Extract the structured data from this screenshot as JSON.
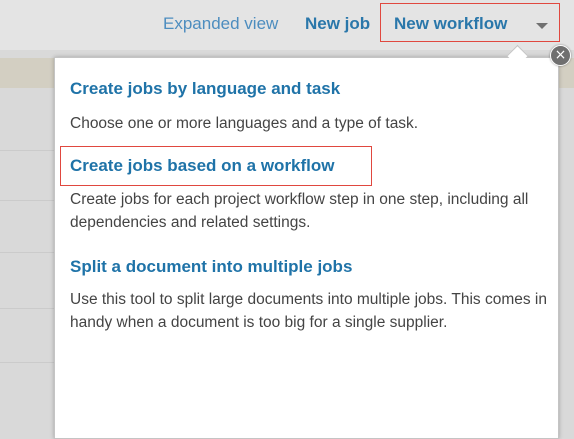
{
  "toolbar": {
    "expanded_view": "Expanded view",
    "new_job": "New job",
    "new_workflow": "New workflow"
  },
  "dropdown": {
    "options": [
      {
        "title": "Create jobs by language and task",
        "description": "Choose one or more languages and a type of task."
      },
      {
        "title": "Create jobs based on a workflow",
        "description": "Create jobs for each project workflow step in one step, including all dependencies and related settings."
      },
      {
        "title": "Split a document into multiple jobs",
        "description": "Use this tool to split large documents into multiple jobs. This comes in handy when a document is too big for a single supplier."
      }
    ],
    "close_glyph": "×"
  },
  "colors": {
    "link": "#1f73a8",
    "highlight": "#e0483f"
  }
}
